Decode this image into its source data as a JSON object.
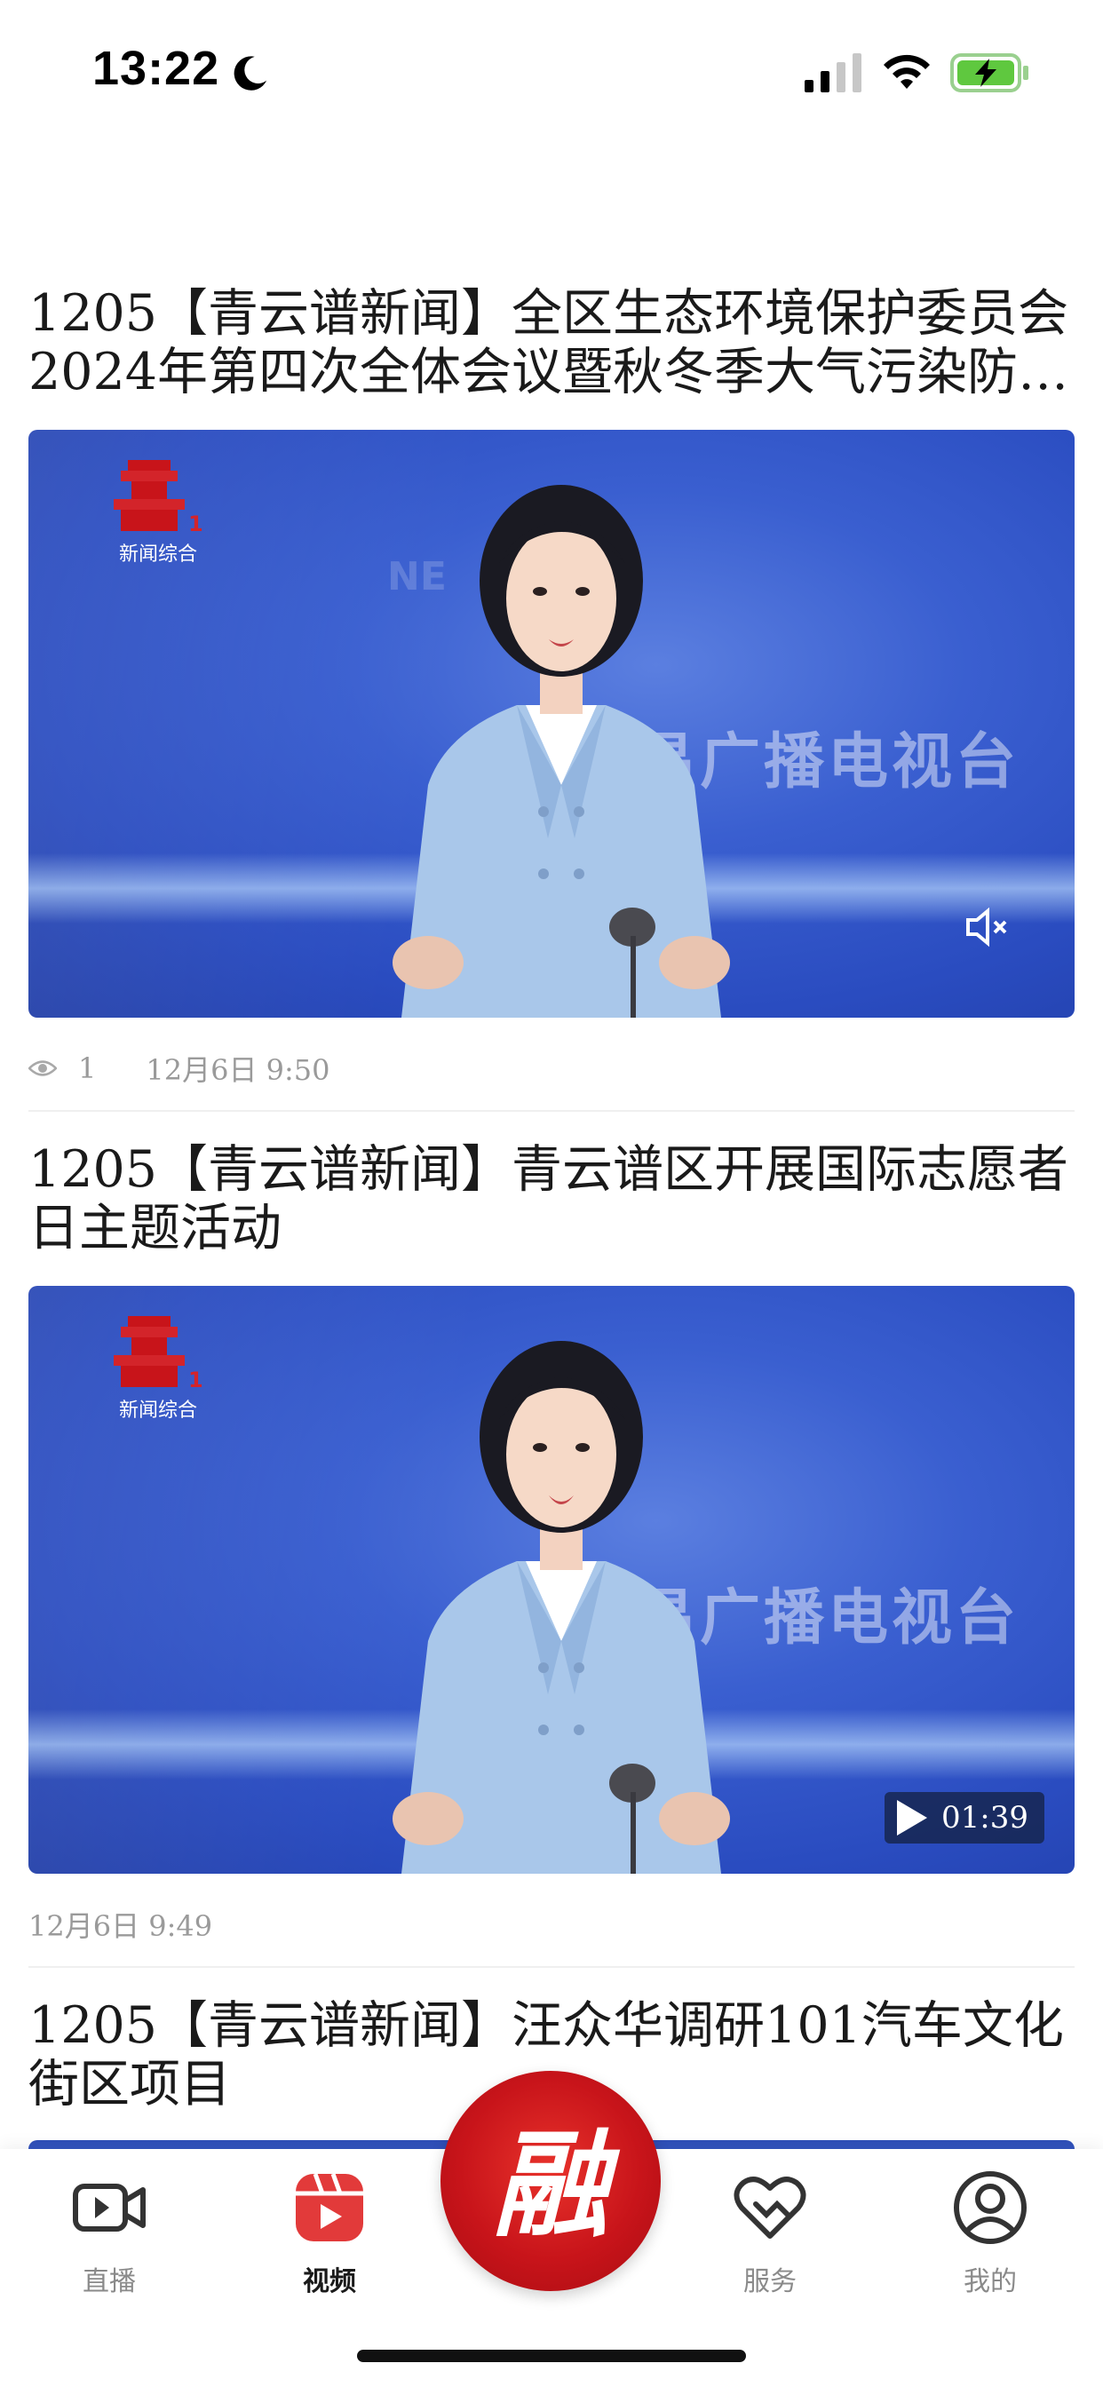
{
  "status_bar": {
    "time": "13:22",
    "icons": [
      "moon-icon",
      "signal-icon",
      "wifi-icon",
      "battery-charging-icon"
    ]
  },
  "feed": {
    "items": [
      {
        "title": "1205【青云谱新闻】全区生态环境保护委员会2024年第四次全体会议暨秋冬季大气污染防治…",
        "video_watermark": "南昌广播电视台",
        "channel_logo_text": "新闻综合",
        "overlay": "mute-icon",
        "views": "1",
        "date": "12月6日  9:50"
      },
      {
        "title": "1205【青云谱新闻】青云谱区开展国际志愿者日主题活动",
        "video_watermark": "南昌广播电视台",
        "channel_logo_text": "新闻综合",
        "overlay": "play-icon",
        "duration": "01:39",
        "date": "12月6日  9:49"
      },
      {
        "title": "1205【青云谱新闻】汪众华调研101汽车文化街区项目"
      }
    ]
  },
  "tab_bar": {
    "tabs": [
      {
        "label": "直播",
        "icon": "live-video-icon",
        "active": false
      },
      {
        "label": "视频",
        "icon": "video-play-icon",
        "active": true
      },
      {
        "label": "融",
        "icon": "rong-center-icon",
        "active": false
      },
      {
        "label": "服务",
        "icon": "handshake-heart-icon",
        "active": false
      },
      {
        "label": "我的",
        "icon": "user-profile-icon",
        "active": false
      }
    ]
  },
  "colors": {
    "accent_red": "#e23a3a",
    "fab_red": "#c8141a",
    "meta_gray": "#9a9a9a",
    "video_blue": "#3a5fd0"
  }
}
